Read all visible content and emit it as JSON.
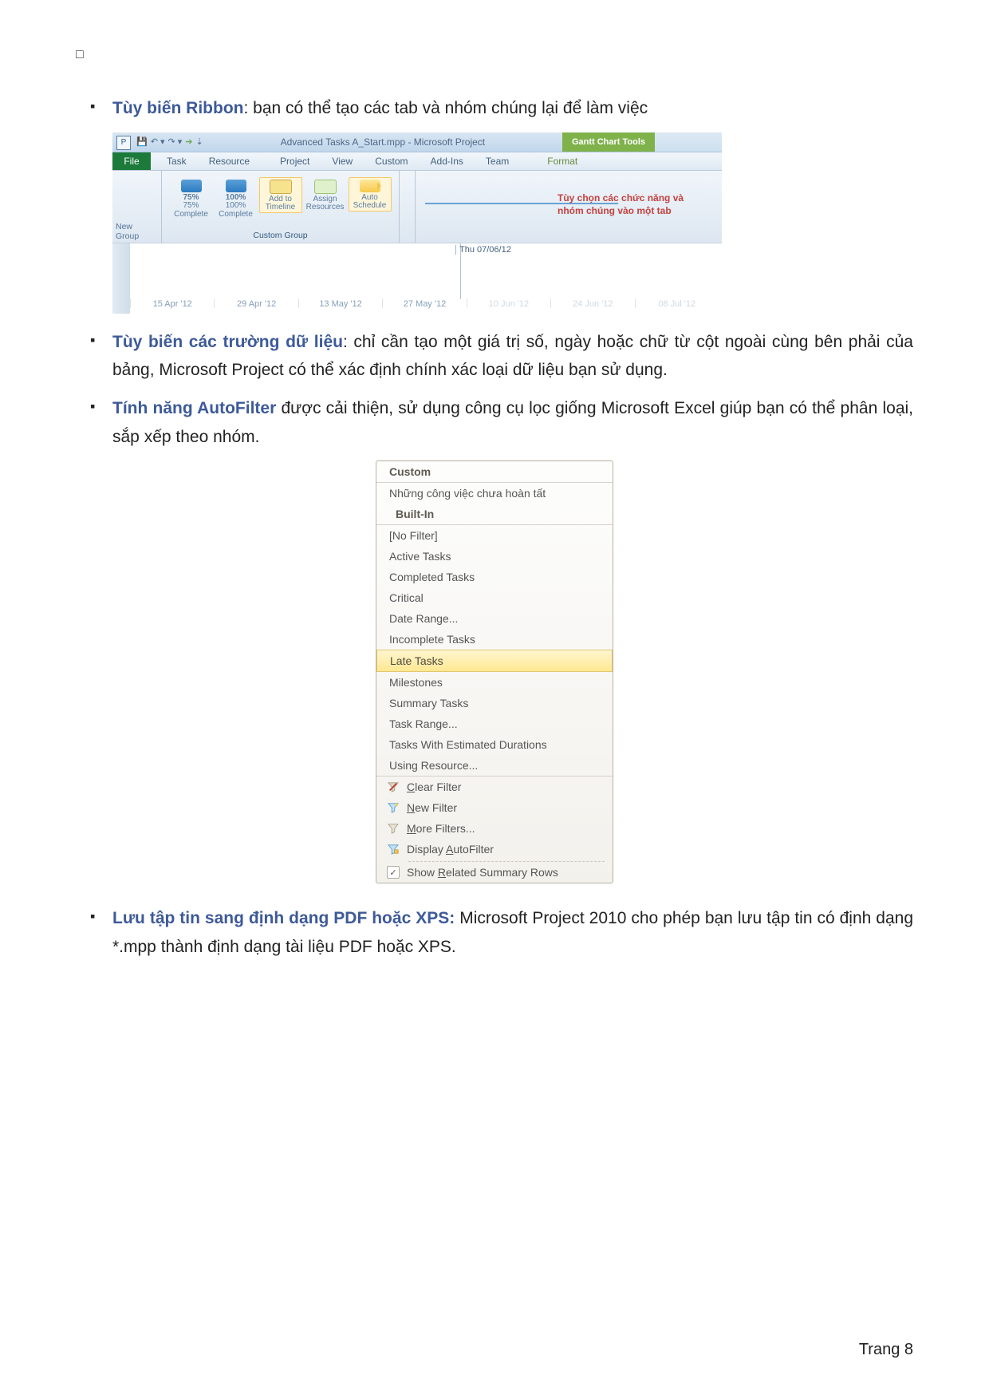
{
  "top_marker": "□",
  "bullets": {
    "b1_title": "Tùy biến Ribbon",
    "b1_rest": ": bạn có thể tạo các tab và nhóm chúng lại để làm việc",
    "b2_title": "Tùy biến các trường dữ liệu",
    "b2_rest": ": chỉ cần tạo một giá trị số, ngày hoặc chữ từ cột ngoài cùng bên phải của bảng, Microsoft Project có thể xác định chính xác loại dữ liệu bạn sử dụng.",
    "b3_title": "Tính năng AutoFilter",
    "b3_rest": " được cải thiện, sử dụng công cụ lọc giống Microsoft Excel giúp bạn có thể phân loại, sắp xếp theo nhóm.",
    "b4_title": "Lưu tập tin sang định dạng PDF hoặc XPS:",
    "b4_rest": " Microsoft Project 2010 cho phép bạn lưu tập tin có định dạng *.mpp thành định dạng tài liệu PDF hoặc XPS."
  },
  "ribbon": {
    "app_icon_letter": "P",
    "qat_undo": "↶ ▾",
    "qat_redo": "↷ ▾",
    "qat_arrow": "➔",
    "qat_more": "⇣",
    "title": "Advanced Tasks A_Start.mpp  -  Microsoft Project",
    "gantt_tools": "Gantt Chart Tools",
    "tabs": {
      "file": "File",
      "task": "Task",
      "resource": "Resource",
      "project": "Project",
      "view": "View",
      "custom": "Custom",
      "addins": "Add-Ins",
      "team": "Team",
      "format": "Format"
    },
    "new_group": "New Group",
    "custom_group": "Custom Group",
    "cg_items": {
      "pct75_big": "75%",
      "pct75_small": "75% Complete",
      "pct100_big": "100%",
      "pct100_small": "100% Complete",
      "addto": "Add to Timeline",
      "assign": "Assign Resources",
      "auto": "Auto Schedule"
    },
    "callout_l1": "Tùy chọn các chức năng và",
    "callout_l2": "nhóm chúng vào một tab",
    "thu": "Thu 07/06/12",
    "ticks": [
      "15 Apr '12",
      "29 Apr '12",
      "13 May '12",
      "27 May '12",
      "10 Jun '12",
      "24 Jun '12",
      "08 Jul '12"
    ]
  },
  "filter": {
    "custom": "Custom",
    "desc": "Những công việc chưa hoàn tất",
    "builtin": "Built-In",
    "items": [
      "[No Filter]",
      "Active Tasks",
      "Completed Tasks",
      "Critical",
      "Date Range...",
      "Incomplete Tasks"
    ],
    "highlight": "Late Tasks",
    "items2": [
      "Milestones",
      "Summary Tasks",
      "Task Range...",
      "Tasks With Estimated Durations",
      "Using Resource..."
    ],
    "clear_pre": "C",
    "clear_rest": "lear Filter",
    "new_pre": "N",
    "new_rest": "ew Filter",
    "more_pre": "M",
    "more_rest": "ore Filters...",
    "disp_pre": "Display ",
    "disp_u": "A",
    "disp_rest": "utoFilter",
    "show_pre": "Show ",
    "show_u": "R",
    "show_rest": "elated Summary Rows",
    "check": "✓"
  },
  "footer": "Trang 8"
}
